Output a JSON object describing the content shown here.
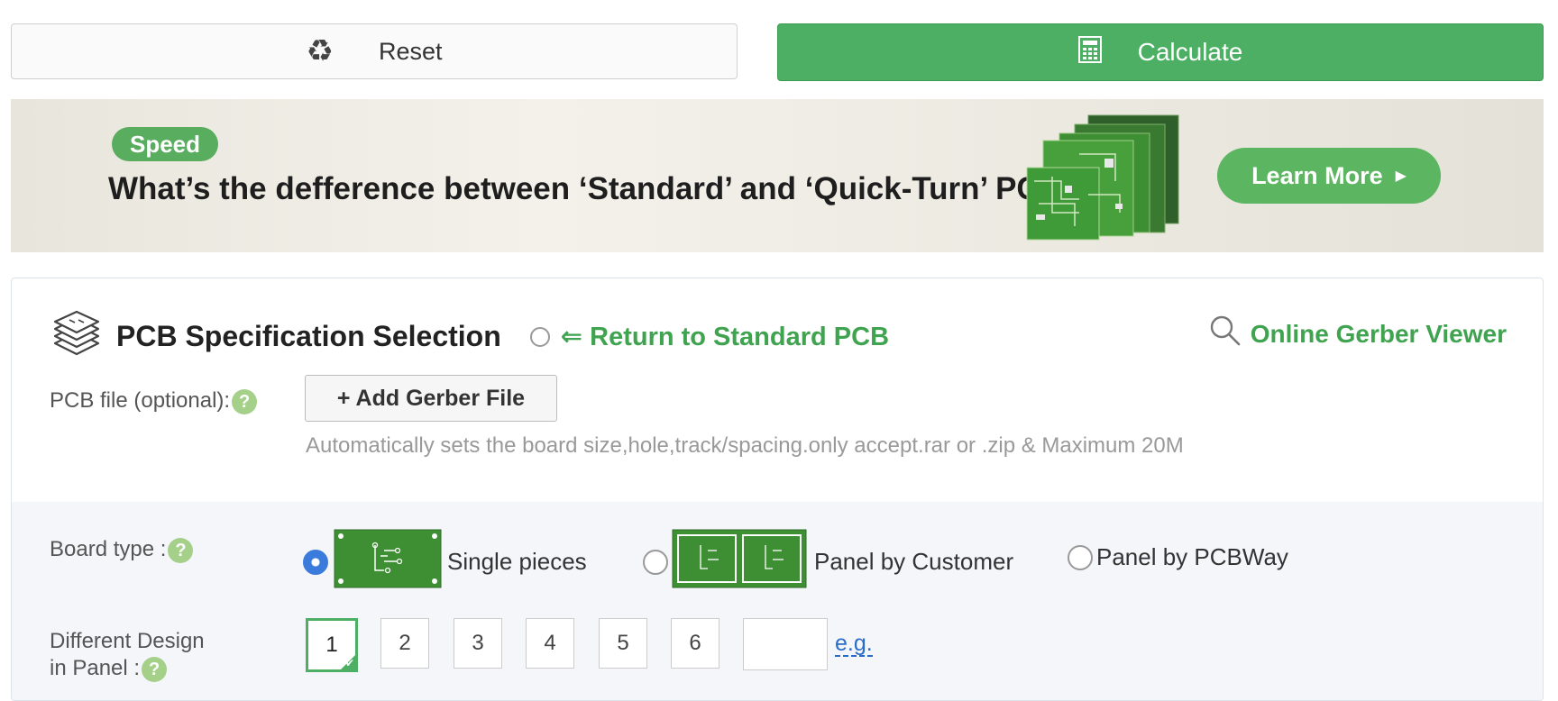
{
  "topbar": {
    "reset_label": "Reset",
    "reset_icon": "recycle-icon",
    "calculate_label": "Calculate",
    "calculate_icon": "calculator-icon"
  },
  "banner": {
    "tag": "Speed",
    "title": "What’s the defference between ‘Standard’ and ‘Quick-Turn’ PCB",
    "button_label": "Learn More"
  },
  "spec": {
    "title": "PCB Specification Selection",
    "return_label": "⇐ Return to Standard PCB",
    "gerber_viewer_label": "Online Gerber Viewer",
    "pcb_file_label": "PCB file (optional):",
    "add_gerber_label": "+ Add Gerber File",
    "hint": "Automatically sets the board size,hole,track/spacing.only accept.rar or .zip & Maximum 20M",
    "board_type_label": "Board type :",
    "board_types": [
      {
        "label": "Single pieces",
        "selected": true
      },
      {
        "label": "Panel by Customer",
        "selected": false
      },
      {
        "label": "Panel by PCBWay",
        "selected": false
      }
    ],
    "design_label_line1": "Different Design",
    "design_label_line2": "in Panel :",
    "design_options": [
      "1",
      "2",
      "3",
      "4",
      "5",
      "6"
    ],
    "design_selected": "1",
    "design_custom_value": "",
    "eg_label": "e.g."
  },
  "colors": {
    "accent_green": "#4caf63",
    "link_green": "#3fa34f",
    "link_blue": "#2a6dc9",
    "pcb_green": "#3e8e33"
  }
}
